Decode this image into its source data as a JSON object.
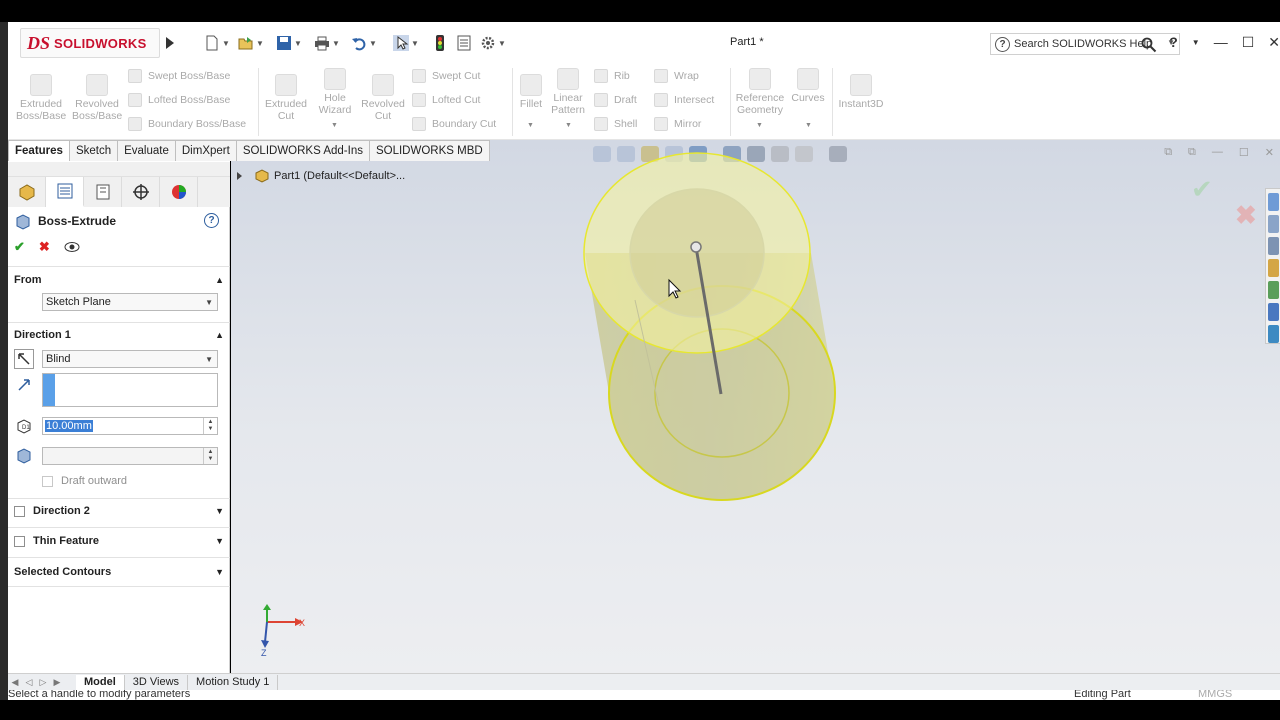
{
  "app": {
    "brand_ds": "DS",
    "brand_name": "SOLIDWORKS",
    "document_title": "Part1 *",
    "search_placeholder": "Search SOLIDWORKS Help"
  },
  "command_manager": {
    "extruded_boss": "Extruded\nBoss/Base",
    "revolved_boss": "Revolved\nBoss/Base",
    "swept_boss": "Swept Boss/Base",
    "lofted_boss": "Lofted Boss/Base",
    "boundary_boss": "Boundary Boss/Base",
    "extruded_cut": "Extruded\nCut",
    "hole_wizard": "Hole\nWizard",
    "revolved_cut": "Revolved\nCut",
    "swept_cut": "Swept Cut",
    "lofted_cut": "Lofted Cut",
    "boundary_cut": "Boundary Cut",
    "fillet": "Fillet",
    "linear_pattern": "Linear\nPattern",
    "rib": "Rib",
    "draft": "Draft",
    "shell": "Shell",
    "wrap": "Wrap",
    "intersect": "Intersect",
    "mirror": "Mirror",
    "reference_geometry": "Reference\nGeometry",
    "curves": "Curves",
    "instant3d": "Instant3D"
  },
  "tabs": [
    "Features",
    "Sketch",
    "Evaluate",
    "DimXpert",
    "SOLIDWORKS Add-Ins",
    "SOLIDWORKS MBD"
  ],
  "property_manager": {
    "title": "Boss-Extrude",
    "from_label": "From",
    "from_value": "Sketch Plane",
    "direction1_label": "Direction 1",
    "end_condition": "Blind",
    "depth_value": "10.00mm",
    "draft_outward": "Draft outward",
    "direction2_label": "Direction 2",
    "thin_feature_label": "Thin Feature",
    "selected_contours_label": "Selected Contours"
  },
  "feature_tree": {
    "root": "Part1  (Default<<Default>..."
  },
  "bottom_tabs": [
    "Model",
    "3D Views",
    "Motion Study 1"
  ],
  "status": {
    "message": "Select a handle to modify parameters",
    "mode": "Editing Part",
    "units": "MMGS"
  },
  "triad": {
    "x": "X",
    "y": "Y",
    "z": "Z"
  },
  "colors": {
    "brand_red": "#c8102e",
    "selection_blue": "#3b7fd6",
    "preview_yellow": "#e8e86a"
  }
}
